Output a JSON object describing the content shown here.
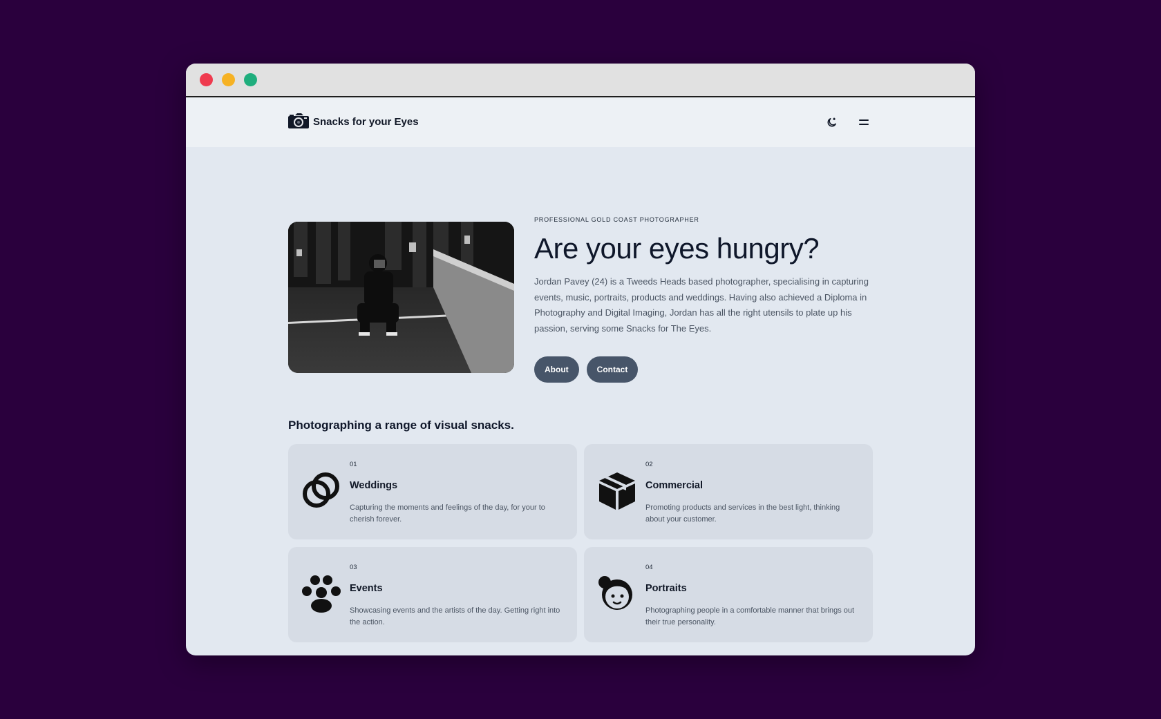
{
  "brand": {
    "name": "Snacks for your Eyes",
    "icon": "camera-icon"
  },
  "nav": {
    "theme_icon": "moon-icon",
    "menu_icon": "hamburger-icon"
  },
  "hero": {
    "eyebrow": "PROFESSIONAL GOLD COAST PHOTOGRAPHER",
    "title": "Are your eyes hungry?",
    "description": "Jordan Pavey (24) is a Tweeds Heads based photographer, specialising in capturing events, music, portraits, products and weddings. Having also achieved a Diploma in Photography and Digital Imaging, Jordan has all the right utensils to plate up his passion, serving some Snacks for The Eyes.",
    "buttons": {
      "about": "About",
      "contact": "Contact"
    }
  },
  "services": {
    "title": "Photographing a range of visual snacks.",
    "items": [
      {
        "num": "01",
        "title": "Weddings",
        "desc": "Capturing the moments and feelings of the day, for your to cherish forever.",
        "icon": "rings-icon"
      },
      {
        "num": "02",
        "title": "Commercial",
        "desc": "Promoting products and services in the best light, thinking about your customer.",
        "icon": "box-icon"
      },
      {
        "num": "03",
        "title": "Events",
        "desc": "Showcasing events and the artists of the day. Getting right into the action.",
        "icon": "crowd-icon"
      },
      {
        "num": "04",
        "title": "Portraits",
        "desc": "Photographing people in a comfortable manner that brings out their true personality.",
        "icon": "face-icon"
      }
    ]
  },
  "colors": {
    "page_bg": "#2a003d",
    "window_bg": "#e2e8f0",
    "button_bg": "#475569",
    "card_bg": "#d6dce5"
  }
}
